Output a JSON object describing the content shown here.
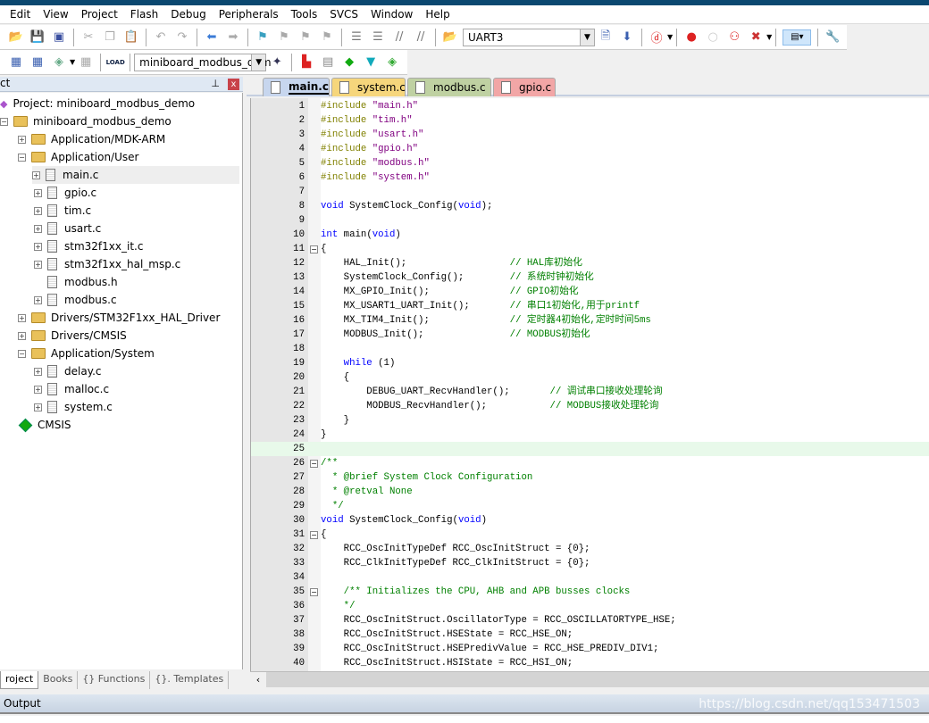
{
  "menu": [
    "Edit",
    "View",
    "Project",
    "Flash",
    "Debug",
    "Peripherals",
    "Tools",
    "SVCS",
    "Window",
    "Help"
  ],
  "toolbar": {
    "find_combo": "UART3",
    "target_combo": "miniboard_modbus_dem",
    "load_label": "LOAD"
  },
  "panel": {
    "title": "ct",
    "pin": "⊥",
    "close": "x"
  },
  "tree": [
    {
      "label": "Project: miniboard_modbus_demo",
      "kind": "project",
      "depth": 0
    },
    {
      "label": "miniboard_modbus_demo",
      "kind": "target",
      "depth": 0,
      "toggle": "-"
    },
    {
      "label": "Application/MDK-ARM",
      "kind": "folder",
      "depth": 1,
      "toggle": "+"
    },
    {
      "label": "Application/User",
      "kind": "folder",
      "depth": 1,
      "toggle": "-"
    },
    {
      "label": "main.c",
      "kind": "file",
      "depth": 2,
      "toggle": "+",
      "selected": true
    },
    {
      "label": "gpio.c",
      "kind": "file",
      "depth": 2,
      "toggle": "+"
    },
    {
      "label": "tim.c",
      "kind": "file",
      "depth": 2,
      "toggle": "+"
    },
    {
      "label": "usart.c",
      "kind": "file",
      "depth": 2,
      "toggle": "+"
    },
    {
      "label": "stm32f1xx_it.c",
      "kind": "file",
      "depth": 2,
      "toggle": "+"
    },
    {
      "label": "stm32f1xx_hal_msp.c",
      "kind": "file",
      "depth": 2,
      "toggle": "+"
    },
    {
      "label": "modbus.h",
      "kind": "file",
      "depth": 2
    },
    {
      "label": "modbus.c",
      "kind": "file",
      "depth": 2,
      "toggle": "+"
    },
    {
      "label": "Drivers/STM32F1xx_HAL_Driver",
      "kind": "folder",
      "depth": 1,
      "toggle": "+"
    },
    {
      "label": "Drivers/CMSIS",
      "kind": "folder",
      "depth": 1,
      "toggle": "+"
    },
    {
      "label": "Application/System",
      "kind": "folder",
      "depth": 1,
      "toggle": "-"
    },
    {
      "label": "delay.c",
      "kind": "file",
      "depth": 2,
      "toggle": "+"
    },
    {
      "label": "malloc.c",
      "kind": "file",
      "depth": 2,
      "toggle": "+"
    },
    {
      "label": "system.c",
      "kind": "file",
      "depth": 2,
      "toggle": "+"
    },
    {
      "label": "CMSIS",
      "kind": "component",
      "depth": 1
    }
  ],
  "left_tabs": [
    "roject",
    "Books",
    "{} Functions",
    "{}. Templates"
  ],
  "tabs": [
    {
      "label": "main.c",
      "color": "#c7d6ee",
      "active": true
    },
    {
      "label": "system.c",
      "color": "#f6d67c"
    },
    {
      "label": "modbus.c",
      "color": "#bfd1a2"
    },
    {
      "label": "gpio.c",
      "color": "#f2a6a6"
    }
  ],
  "code": [
    [
      [
        "pp",
        "#include "
      ],
      [
        "st",
        "\"main.h\""
      ]
    ],
    [
      [
        "pp",
        "#include "
      ],
      [
        "st",
        "\"tim.h\""
      ]
    ],
    [
      [
        "pp",
        "#include "
      ],
      [
        "st",
        "\"usart.h\""
      ]
    ],
    [
      [
        "pp",
        "#include "
      ],
      [
        "st",
        "\"gpio.h\""
      ]
    ],
    [
      [
        "pp",
        "#include "
      ],
      [
        "st",
        "\"modbus.h\""
      ]
    ],
    [
      [
        "pp",
        "#include "
      ],
      [
        "st",
        "\"system.h\""
      ]
    ],
    [],
    [
      [
        "kw",
        "void"
      ],
      [
        "tx",
        " SystemClock_Config("
      ],
      [
        "kw",
        "void"
      ],
      [
        "tx",
        ");"
      ]
    ],
    [],
    [
      [
        "kw",
        "int"
      ],
      [
        "tx",
        " main("
      ],
      [
        "kw",
        "void"
      ],
      [
        "tx",
        ")"
      ]
    ],
    [
      [
        "tx",
        "{"
      ]
    ],
    [
      [
        "tx",
        "    HAL_Init();                  "
      ],
      [
        "cm",
        "// HAL库初始化"
      ]
    ],
    [
      [
        "tx",
        "    SystemClock_Config();        "
      ],
      [
        "cm",
        "// 系统时钟初始化"
      ]
    ],
    [
      [
        "tx",
        "    MX_GPIO_Init();              "
      ],
      [
        "cm",
        "// GPIO初始化"
      ]
    ],
    [
      [
        "tx",
        "    MX_USART1_UART_Init();       "
      ],
      [
        "cm",
        "// 串口1初始化,用于printf"
      ]
    ],
    [
      [
        "tx",
        "    MX_TIM4_Init();              "
      ],
      [
        "cm",
        "// 定时器4初始化,定时时间5ms"
      ]
    ],
    [
      [
        "tx",
        "    MODBUS_Init();               "
      ],
      [
        "cm",
        "// MODBUS初始化"
      ]
    ],
    [],
    [
      [
        "tx",
        "    "
      ],
      [
        "kw",
        "while"
      ],
      [
        "tx",
        " (1)"
      ]
    ],
    [
      [
        "tx",
        "    {"
      ]
    ],
    [
      [
        "tx",
        "        DEBUG_UART_RecvHandler();       "
      ],
      [
        "cm",
        "// 调试串口接收处理轮询"
      ]
    ],
    [
      [
        "tx",
        "        MODBUS_RecvHandler();           "
      ],
      [
        "cm",
        "// MODBUS接收处理轮询"
      ]
    ],
    [
      [
        "tx",
        "    }"
      ]
    ],
    [
      [
        "tx",
        "}"
      ]
    ],
    [],
    [
      [
        "cm",
        "/**"
      ]
    ],
    [
      [
        "cm",
        "  * @brief System Clock Configuration"
      ]
    ],
    [
      [
        "cm",
        "  * @retval None"
      ]
    ],
    [
      [
        "cm",
        "  */"
      ]
    ],
    [
      [
        "kw",
        "void"
      ],
      [
        "tx",
        " SystemClock_Config("
      ],
      [
        "kw",
        "void"
      ],
      [
        "tx",
        ")"
      ]
    ],
    [
      [
        "tx",
        "{"
      ]
    ],
    [
      [
        "tx",
        "    RCC_OscInitTypeDef RCC_OscInitStruct = {0};"
      ]
    ],
    [
      [
        "tx",
        "    RCC_ClkInitTypeDef RCC_ClkInitStruct = {0};"
      ]
    ],
    [],
    [
      [
        "cm",
        "    /** Initializes the CPU, AHB and APB busses clocks"
      ]
    ],
    [
      [
        "cm",
        "    */"
      ]
    ],
    [
      [
        "tx",
        "    RCC_OscInitStruct.OscillatorType = RCC_OSCILLATORTYPE_HSE;"
      ]
    ],
    [
      [
        "tx",
        "    RCC_OscInitStruct.HSEState = RCC_HSE_ON;"
      ]
    ],
    [
      [
        "tx",
        "    RCC_OscInitStruct.HSEPredivValue = RCC_HSE_PREDIV_DIV1;"
      ]
    ],
    [
      [
        "tx",
        "    RCC_OscInitStruct.HSIState = RCC_HSI_ON;"
      ]
    ]
  ],
  "folds": {
    "11": "-",
    "26": "-",
    "31": "-",
    "35": "-"
  },
  "highlight_line": 25,
  "output": {
    "title": "Output",
    "watermark": "https://blog.csdn.net/qq153471503"
  },
  "colors": {
    "keyword": "#0000ff",
    "preprocessor": "#808000",
    "string": "#800080",
    "comment": "#008000",
    "titlebar": "#0b4870"
  }
}
